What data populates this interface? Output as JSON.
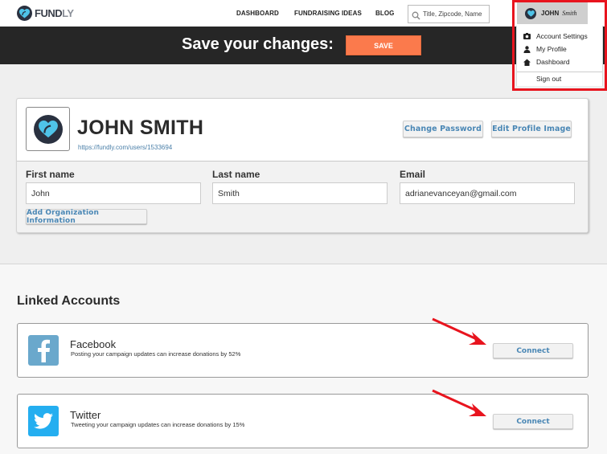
{
  "brand": {
    "name_main": "FUND",
    "name_tail": "LY",
    "accent_color": "#4fc3e8",
    "dark_color": "#2a3140"
  },
  "nav": {
    "links": [
      "DASHBOARD",
      "FUNDRAISING IDEAS",
      "BLOG"
    ],
    "search_placeholder": "Title, Zipcode, Name",
    "search_value": ""
  },
  "user_menu": {
    "first": "JOHN",
    "last": "Smith",
    "items": [
      {
        "label": "Account Settings",
        "icon": "settings-icon"
      },
      {
        "label": "My Profile",
        "icon": "user-icon"
      },
      {
        "label": "Dashboard",
        "icon": "home-icon"
      }
    ],
    "sign_out": "Sign out"
  },
  "save_bar": {
    "text": "Save your changes:",
    "button": "SAVE",
    "button_color": "#fb7a4c"
  },
  "profile": {
    "name": "JOHN SMITH",
    "url": "https://fundly.com/users/1533694",
    "change_password": "Change Password",
    "edit_image": "Edit Profile Image",
    "fields": {
      "first_name": {
        "label": "First name",
        "value": "John"
      },
      "last_name": {
        "label": "Last name",
        "value": "Smith"
      },
      "email": {
        "label": "Email",
        "value": "adrianevanceyan@gmail.com"
      }
    },
    "add_org": "Add Organization Information"
  },
  "linked_accounts": {
    "title": "Linked Accounts",
    "accounts": [
      {
        "name": "Facebook",
        "description": "Posting your campaign updates can increase donations by 52%",
        "button": "Connect",
        "color": "#6aa8cc"
      },
      {
        "name": "Twitter",
        "description": "Tweeting your campaign updates can increase donations by 15%",
        "button": "Connect",
        "color": "#24aef0"
      }
    ]
  },
  "annotation": {
    "highlight_color": "#e8141e"
  }
}
